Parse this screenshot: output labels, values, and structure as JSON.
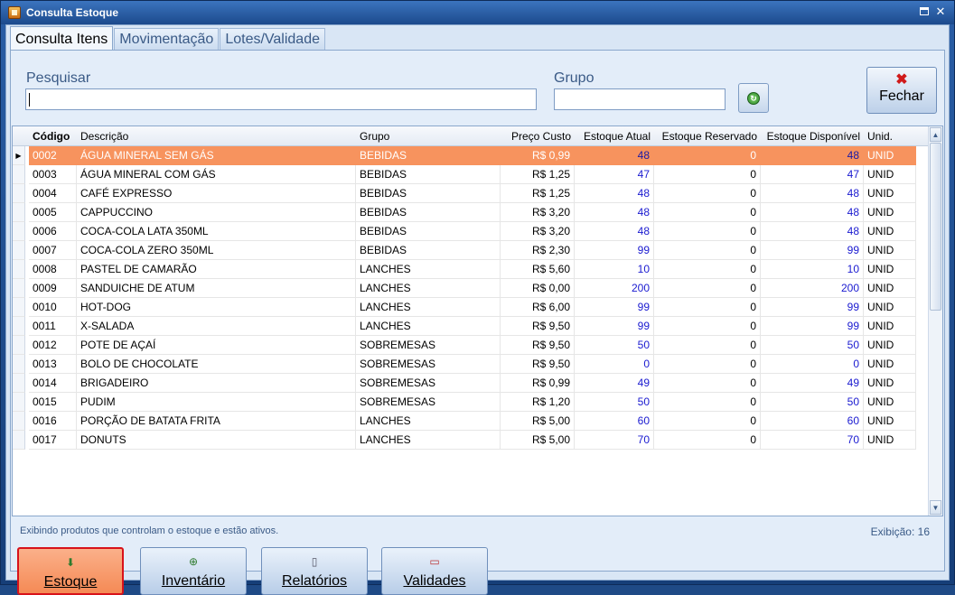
{
  "window": {
    "title": "Consulta Estoque"
  },
  "tabs": [
    {
      "label": "Consulta Itens",
      "active": true
    },
    {
      "label": "Movimentação",
      "active": false
    },
    {
      "label": "Lotes/Validade",
      "active": false
    }
  ],
  "search": {
    "label": "Pesquisar",
    "value": ""
  },
  "group": {
    "label": "Grupo",
    "value": ""
  },
  "close_button": {
    "label": "Fechar",
    "icon": "red-x-icon"
  },
  "table": {
    "columns": [
      "Código",
      "Descrição",
      "Grupo",
      "Preço Custo",
      "Estoque Atual",
      "Estoque Reservado",
      "Estoque Disponível",
      "Unid."
    ],
    "rows": [
      [
        "0002",
        "ÁGUA MINERAL SEM GÁS",
        "BEBIDAS",
        "R$ 0,99",
        "48",
        "0",
        "48",
        "UNID"
      ],
      [
        "0003",
        "ÁGUA MINERAL COM GÁS",
        "BEBIDAS",
        "R$ 1,25",
        "47",
        "0",
        "47",
        "UNID"
      ],
      [
        "0004",
        "CAFÉ EXPRESSO",
        "BEBIDAS",
        "R$ 1,25",
        "48",
        "0",
        "48",
        "UNID"
      ],
      [
        "0005",
        "CAPPUCCINO",
        "BEBIDAS",
        "R$ 3,20",
        "48",
        "0",
        "48",
        "UNID"
      ],
      [
        "0006",
        "COCA-COLA LATA 350ML",
        "BEBIDAS",
        "R$ 3,20",
        "48",
        "0",
        "48",
        "UNID"
      ],
      [
        "0007",
        "COCA-COLA ZERO 350ML",
        "BEBIDAS",
        "R$ 2,30",
        "99",
        "0",
        "99",
        "UNID"
      ],
      [
        "0008",
        "PASTEL DE CAMARÃO",
        "LANCHES",
        "R$ 5,60",
        "10",
        "0",
        "10",
        "UNID"
      ],
      [
        "0009",
        "SANDUICHE DE ATUM",
        "LANCHES",
        "R$ 0,00",
        "200",
        "0",
        "200",
        "UNID"
      ],
      [
        "0010",
        "HOT-DOG",
        "LANCHES",
        "R$ 6,00",
        "99",
        "0",
        "99",
        "UNID"
      ],
      [
        "0011",
        "X-SALADA",
        "LANCHES",
        "R$ 9,50",
        "99",
        "0",
        "99",
        "UNID"
      ],
      [
        "0012",
        "POTE DE AÇAÍ",
        "SOBREMESAS",
        "R$ 9,50",
        "50",
        "0",
        "50",
        "UNID"
      ],
      [
        "0013",
        "BOLO DE CHOCOLATE",
        "SOBREMESAS",
        "R$ 9,50",
        "0",
        "0",
        "0",
        "UNID"
      ],
      [
        "0014",
        "BRIGADEIRO",
        "SOBREMESAS",
        "R$ 0,99",
        "49",
        "0",
        "49",
        "UNID"
      ],
      [
        "0015",
        "PUDIM",
        "SOBREMESAS",
        "R$ 1,20",
        "50",
        "0",
        "50",
        "UNID"
      ],
      [
        "0016",
        "PORÇÃO DE BATATA FRITA",
        "LANCHES",
        "R$ 5,00",
        "60",
        "0",
        "60",
        "UNID"
      ],
      [
        "0017",
        "DONUTS",
        "LANCHES",
        "R$ 5,00",
        "70",
        "0",
        "70",
        "UNID"
      ]
    ],
    "selected_row": 0
  },
  "status": {
    "message": "Exibindo produtos que controlam o estoque e estão ativos.",
    "count": "Exibição: 16"
  },
  "bottom_buttons": [
    {
      "label": "Estoque",
      "icon": "stock-icon",
      "active": true
    },
    {
      "label": "Inventário",
      "icon": "add-circle-icon",
      "active": false
    },
    {
      "label": "Relatórios",
      "icon": "report-icon",
      "active": false
    },
    {
      "label": "Validades",
      "icon": "calendar-icon",
      "active": false
    }
  ],
  "colors": {
    "selected_row": "#f7935e",
    "number_blue": "#1a1ad0",
    "active_button_border": "#d8121a"
  }
}
